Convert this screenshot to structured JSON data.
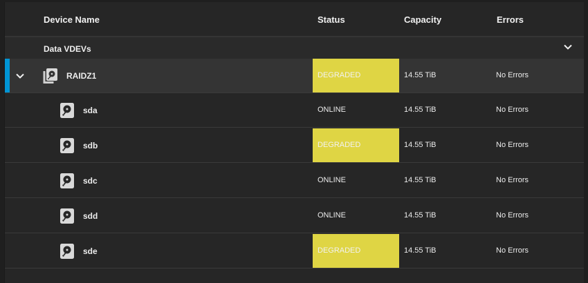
{
  "columns": {
    "device_name": "Device Name",
    "status": "Status",
    "capacity": "Capacity",
    "errors": "Errors"
  },
  "group": {
    "label": "Data VDEVs",
    "toggle_icon": "chevron-down-icon"
  },
  "colors": {
    "degraded": "#dfd544",
    "accent": "#0095d5"
  },
  "vdev": {
    "name": "RAIDZ1",
    "status": "DEGRADED",
    "capacity": "14.55 TiB",
    "errors": "No Errors",
    "icon": "pool-disks-icon"
  },
  "disks": [
    {
      "name": "sda",
      "status": "ONLINE",
      "capacity": "14.55 TiB",
      "errors": "No Errors",
      "icon": "hard-disk-icon"
    },
    {
      "name": "sdb",
      "status": "DEGRADED",
      "capacity": "14.55 TiB",
      "errors": "No Errors",
      "icon": "hard-disk-icon"
    },
    {
      "name": "sdc",
      "status": "ONLINE",
      "capacity": "14.55 TiB",
      "errors": "No Errors",
      "icon": "hard-disk-icon"
    },
    {
      "name": "sdd",
      "status": "ONLINE",
      "capacity": "14.55 TiB",
      "errors": "No Errors",
      "icon": "hard-disk-icon"
    },
    {
      "name": "sde",
      "status": "DEGRADED",
      "capacity": "14.55 TiB",
      "errors": "No Errors",
      "icon": "hard-disk-icon"
    }
  ]
}
